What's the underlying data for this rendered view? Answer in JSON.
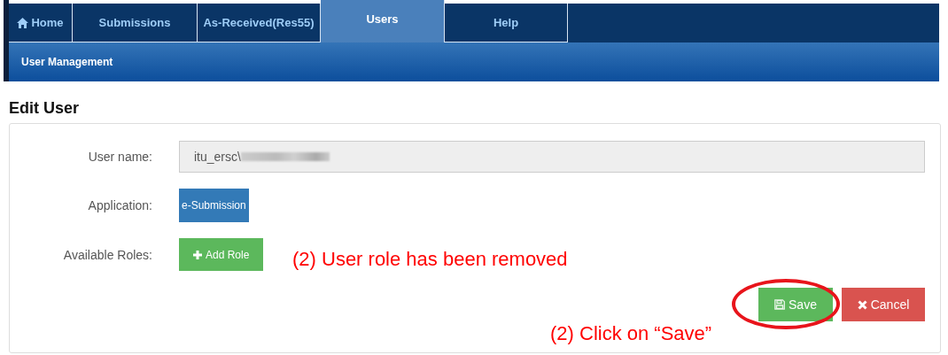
{
  "nav": {
    "tabs": [
      {
        "kind": "home",
        "label": "Home",
        "selected": false
      },
      {
        "kind": "plain",
        "label": "Submissions",
        "selected": false
      },
      {
        "kind": "plain",
        "label": "As-Received(Res55)",
        "selected": false
      },
      {
        "kind": "plain",
        "label": "Users",
        "selected": true
      },
      {
        "kind": "plain",
        "label": "Help",
        "selected": false
      }
    ],
    "subtab": "User Management"
  },
  "heading": "Edit User",
  "form": {
    "fields": [
      {
        "kind": "text",
        "label": "User name:",
        "value": "itu_ersc\\",
        "redacted": true
      },
      {
        "kind": "badge",
        "label": "Application:",
        "value": "e-Submission"
      },
      {
        "kind": "button",
        "label": "Available Roles:",
        "value": "Add Role"
      }
    ],
    "actions": [
      {
        "kind": "save",
        "label": "Save"
      },
      {
        "kind": "cancel",
        "label": "Cancel"
      }
    ]
  },
  "annotations": [
    {
      "kind": "note",
      "text": "(2) User role has been removed"
    },
    {
      "kind": "callout",
      "text": "(2) Click on “Save”"
    }
  ]
}
